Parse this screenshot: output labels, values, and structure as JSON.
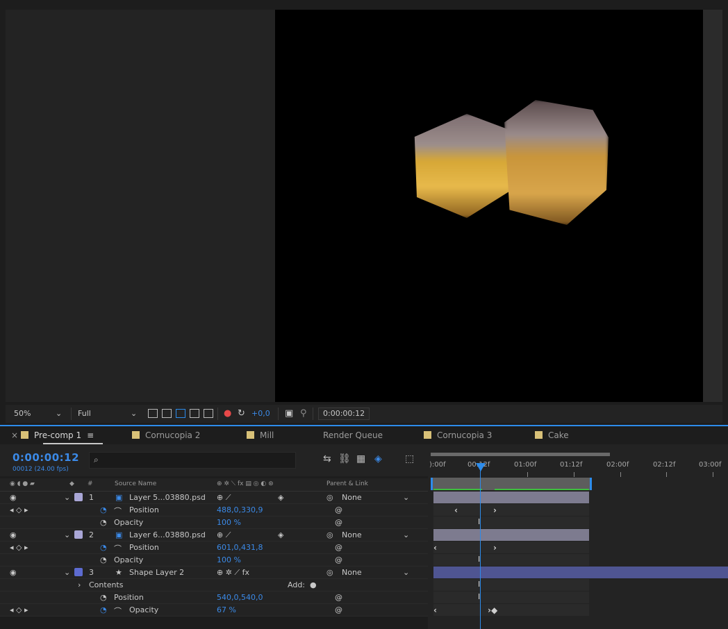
{
  "viewer": {
    "zoom": "50%",
    "resolution": "Full",
    "exposure": "+0,0",
    "timecode": "0:00:00:12"
  },
  "tabs": [
    {
      "label": "Pre-comp 1",
      "color": "#d8c178",
      "active": true
    },
    {
      "label": "Cornucopia 2",
      "color": "#d8c178"
    },
    {
      "label": "Mill",
      "color": "#c8a57a"
    },
    {
      "label": "Render Queue",
      "color": ""
    },
    {
      "label": "Cornucopia 3",
      "color": "#d8c178"
    },
    {
      "label": "Cake",
      "color": "#d8c178"
    }
  ],
  "timeline": {
    "timecode": "0:00:00:12",
    "frames": "00012 (24.00 fps)",
    "search_placeholder": "",
    "columns": {
      "source_name": "Source Name",
      "parent": "Parent & Link",
      "hash": "#"
    },
    "ruler": [
      "):00f",
      "00:12f",
      "01:00f",
      "01:12f",
      "02:00f",
      "02:12f",
      "03:00f"
    ]
  },
  "layers": [
    {
      "num": "1",
      "name": "Layer 5...03880.psd",
      "parent": "None",
      "color": "#a9a6d6"
    },
    {
      "prop": "Position",
      "value": "488,0,330,9"
    },
    {
      "prop": "Opacity",
      "value": "100 %"
    },
    {
      "num": "2",
      "name": "Layer 6...03880.psd",
      "parent": "None",
      "color": "#a9a6d6"
    },
    {
      "prop": "Position",
      "value": "601,0,431,8"
    },
    {
      "prop": "Opacity",
      "value": "100 %"
    },
    {
      "num": "3",
      "name": "Shape Layer 2",
      "parent": "None",
      "color": "#5d6bd0"
    },
    {
      "prop": "Contents",
      "add": "Add:"
    },
    {
      "prop": "Position",
      "value": "540,0,540,0"
    },
    {
      "prop": "Opacity",
      "value": "67 %"
    }
  ]
}
